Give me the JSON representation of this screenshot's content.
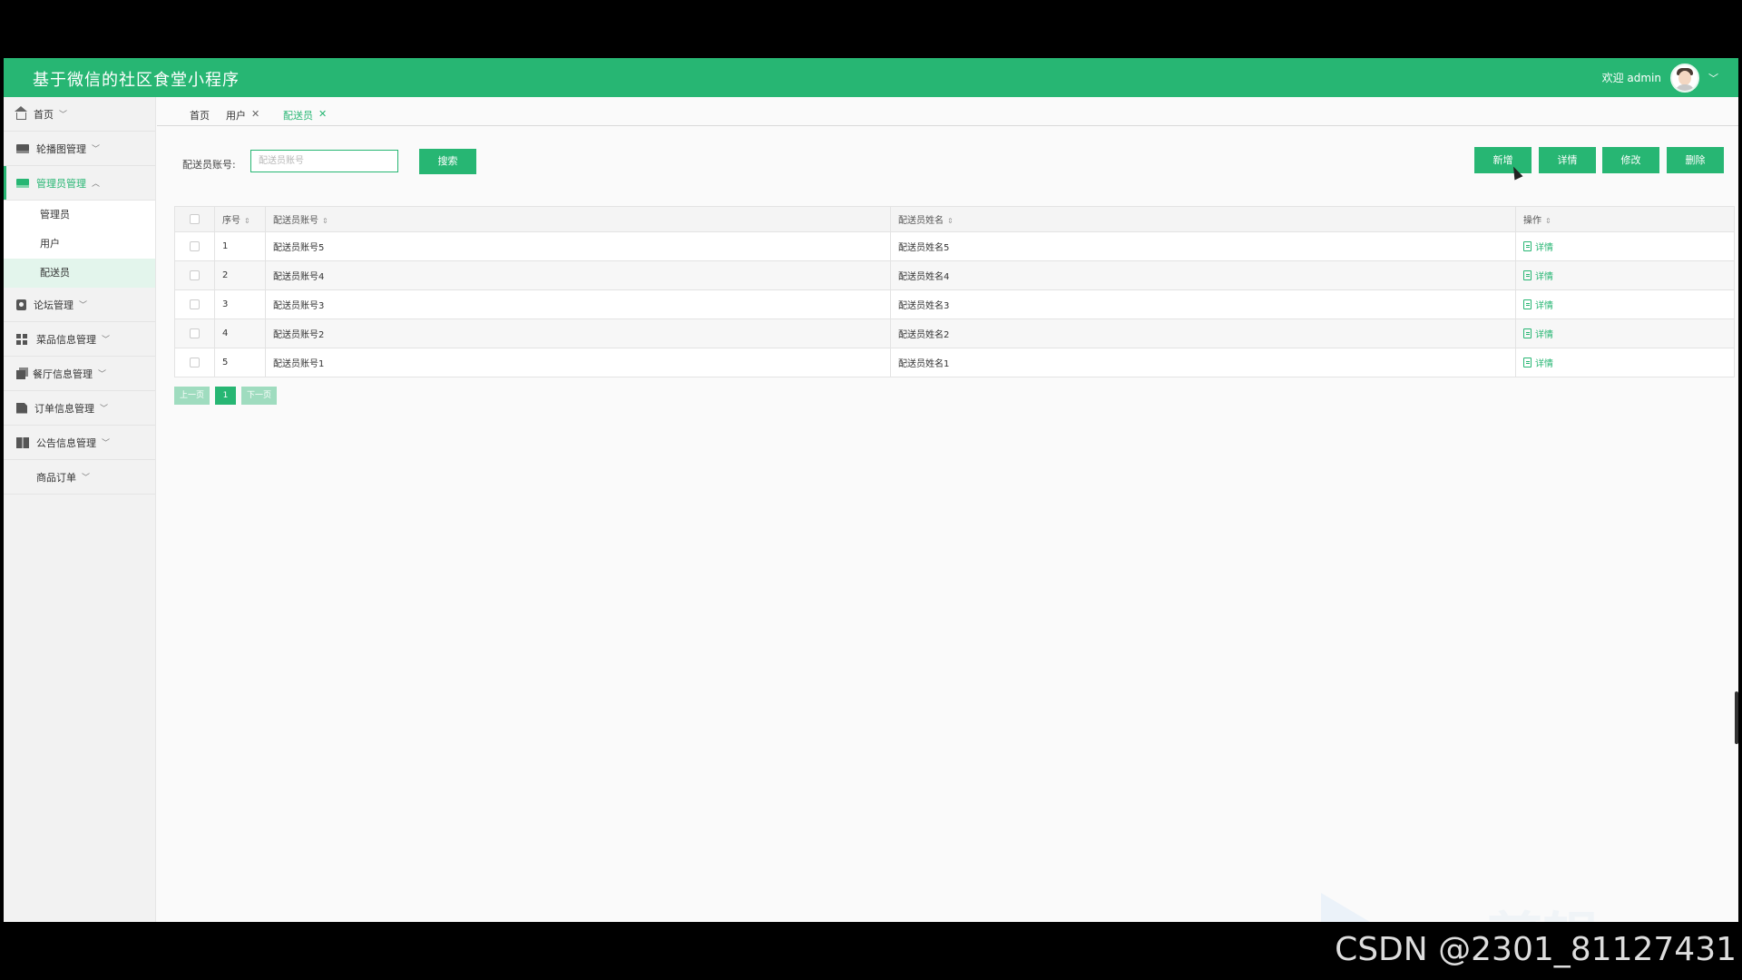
{
  "header": {
    "app_title": "基于微信的社区食堂小程序",
    "welcome": "欢迎 admin",
    "chevron_icon": "chevron-down-icon"
  },
  "sidebar": {
    "items": [
      {
        "label": "首页",
        "icon": "home-icon"
      },
      {
        "label": "轮播图管理",
        "icon": "banner-icon"
      },
      {
        "label": "管理员管理",
        "icon": "admin-icon",
        "expanded": true
      },
      {
        "label": "论坛管理",
        "icon": "forum-icon"
      },
      {
        "label": "菜品信息管理",
        "icon": "grid-icon"
      },
      {
        "label": "餐厅信息管理",
        "icon": "copy-icon"
      },
      {
        "label": "订单信息管理",
        "icon": "order-icon"
      },
      {
        "label": "公告信息管理",
        "icon": "book-icon"
      },
      {
        "label": "商品订单",
        "icon": ""
      }
    ],
    "subitems": [
      "管理员",
      "用户",
      "配送员"
    ]
  },
  "tabs": [
    {
      "label": "首页"
    },
    {
      "label": "用户",
      "close": "✕"
    },
    {
      "label": "配送员",
      "close": "✕",
      "active": true
    }
  ],
  "search": {
    "label": "配送员账号:",
    "placeholder": "配送员账号",
    "button": "搜索"
  },
  "toolbar": {
    "add": "新增",
    "detail": "详情",
    "edit": "修改",
    "delete": "删除"
  },
  "table": {
    "headers": [
      "序号",
      "配送员账号",
      "配送员姓名",
      "操作"
    ],
    "rows": [
      {
        "index": "1",
        "account": "配送员账号5",
        "name": "配送员姓名5",
        "action": "详情"
      },
      {
        "index": "2",
        "account": "配送员账号4",
        "name": "配送员姓名4",
        "action": "详情"
      },
      {
        "index": "3",
        "account": "配送员账号3",
        "name": "配送员姓名3",
        "action": "详情"
      },
      {
        "index": "4",
        "account": "配送员账号2",
        "name": "配送员姓名2",
        "action": "详情"
      },
      {
        "index": "5",
        "account": "配送员账号1",
        "name": "配送员姓名1",
        "action": "详情"
      }
    ]
  },
  "pagination": {
    "prev": "上一页",
    "current": "1",
    "next": "下一页"
  },
  "watermark": {
    "ev": "ev剪辑",
    "csdn": "CSDN @2301_81127431"
  },
  "colors": {
    "primary": "#27b673",
    "pager_disabled": "#9fdcbf"
  }
}
